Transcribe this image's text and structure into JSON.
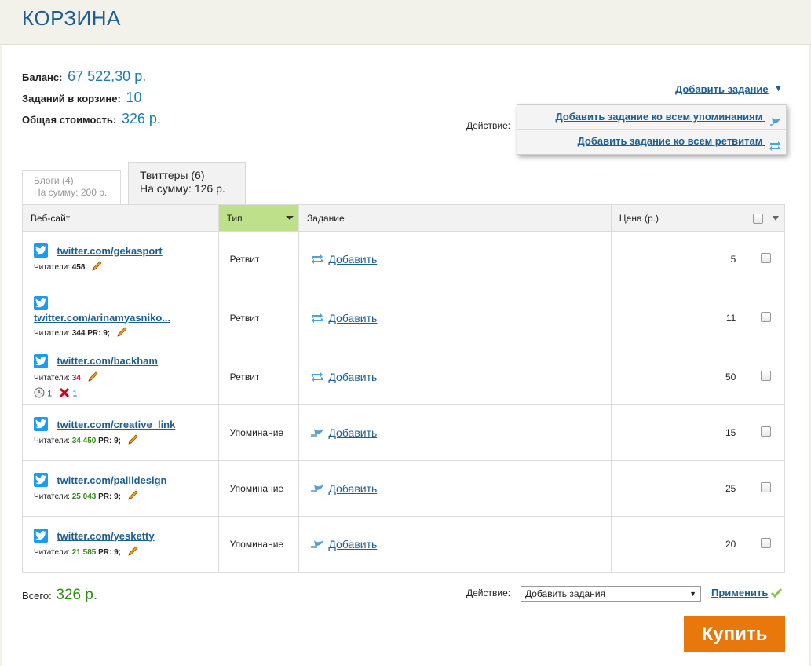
{
  "page": {
    "title": "КОРЗИНА"
  },
  "summary": {
    "balance_label": "Баланс:",
    "balance_value": "67 522,30 р.",
    "tasks_label": "Заданий в корзине:",
    "tasks_value": "10",
    "cost_label": "Общая стоимость:",
    "cost_value": "326 р."
  },
  "add_task": {
    "label": "Добавить задание",
    "arrow": "▼",
    "action_label": "Действие:",
    "menu": [
      {
        "label": "Добавить задание ко всем упоминаниям",
        "icon": "mention-icon"
      },
      {
        "label": "Добавить задание ко всем ретвитам",
        "icon": "retweet-icon"
      }
    ]
  },
  "tabs": [
    {
      "line1": "Блоги (4)",
      "line2": "На сумму: 200 р.",
      "active": false
    },
    {
      "line1": "Твиттеры (6)",
      "line2": "На сумму: 126 р.",
      "active": true
    }
  ],
  "table": {
    "headers": {
      "site": "Веб-сайт",
      "type": "Тип",
      "task": "Задание",
      "price": "Цена (р.)"
    },
    "rows": [
      {
        "site": "twitter.com/gekasport",
        "readers_label": "Читатели:",
        "readers": "458",
        "pr": "",
        "type": "Ретвит",
        "task_icon": "retweet-icon",
        "task": "Добавить",
        "price": "5"
      },
      {
        "site": "twitter.com/arinamyasniko...",
        "readers_label": "Читатели:",
        "readers": "344",
        "pr": "PR: 9;",
        "type": "Ретвит",
        "task_icon": "retweet-icon",
        "task": "Добавить",
        "price": "11"
      },
      {
        "site": "twitter.com/backham",
        "readers_label": "Читатели:",
        "readers": "34",
        "pr": "",
        "extra_clock": "1",
        "extra_x": "1",
        "type": "Ретвит",
        "task_icon": "retweet-icon",
        "task": "Добавить",
        "price": "50"
      },
      {
        "site": "twitter.com/creative_link",
        "readers_label": "Читатели:",
        "readers": "34 450",
        "pr": "PR: 9;",
        "type": "Упоминание",
        "task_icon": "mention-icon",
        "task": "Добавить",
        "price": "15"
      },
      {
        "site": "twitter.com/pallldesign",
        "readers_label": "Читатели:",
        "readers": "25 043",
        "pr": "PR: 9;",
        "type": "Упоминание",
        "task_icon": "mention-icon",
        "task": "Добавить",
        "price": "25"
      },
      {
        "site": "twitter.com/yesketty",
        "readers_label": "Читатели:",
        "readers": "21 585",
        "pr": "PR: 9;",
        "type": "Упоминание",
        "task_icon": "mention-icon",
        "task": "Добавить",
        "price": "20"
      }
    ]
  },
  "footer": {
    "total_label": "Всего:",
    "total_value": "326 р.",
    "action_label": "Действие:",
    "select_value": "Добавить задания",
    "apply_label": "Применить",
    "buy_label": "Купить"
  },
  "colors": {
    "link": "#1b5f94",
    "accent_green": "#2e8b14",
    "buy": "#e8780c",
    "sorted_header": "#bfe08a"
  }
}
